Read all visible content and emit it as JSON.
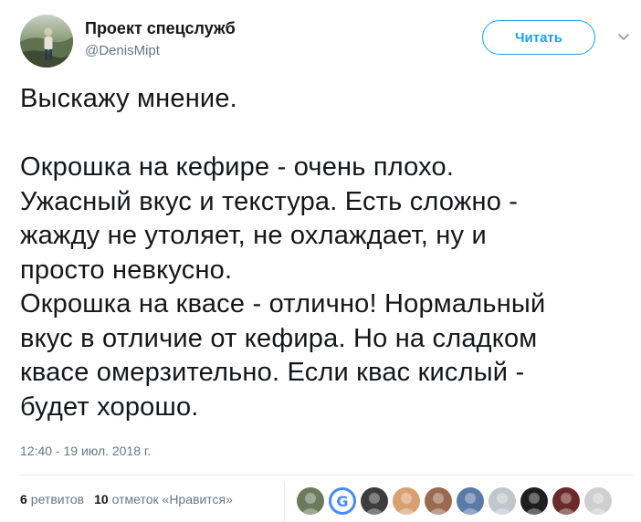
{
  "author": {
    "display_name": "Проект спецслужб",
    "handle": "@DenisMipt",
    "avatar_icon": "profile-photo-icon"
  },
  "follow_button": {
    "label": "Читать",
    "color": "#1da1f2"
  },
  "menu_caret": {
    "icon": "chevron-down-icon"
  },
  "tweet": {
    "text": "Выскажу мнение.\n\nОкрошка на кефире - очень плохо.\nУжасный вкус и текстура. Есть сложно -\nжажду не утоляет, не охлаждает, ну и\nпросто невкусно.\nОкрошка на квасе - отлично! Нормальный\nвкус в отличие от кефира. Но на сладком\nквасе омерзительно. Если квас кислый -\nбудет хорошо.",
    "timestamp": "12:40 - 19 июл. 2018 г."
  },
  "stats": {
    "retweets_count": "6",
    "retweets_label": "ретвитов",
    "likes_count": "10",
    "likes_label": "отметок «Нравится»"
  },
  "likers": [
    {
      "icon": "liker-avatar-icon",
      "color": "#6b7a5a"
    },
    {
      "icon": "google-g-icon",
      "letter": "G",
      "color": "#4a8af4"
    },
    {
      "icon": "liker-avatar-icon",
      "color": "#3d3d3d"
    },
    {
      "icon": "cat-avatar-icon",
      "color": "#d8a070"
    },
    {
      "icon": "liker-avatar-icon",
      "color": "#9a6a50"
    },
    {
      "icon": "liker-avatar-icon",
      "color": "#5a7aa8"
    },
    {
      "icon": "default-avatar-icon",
      "color": "#c0c6cc"
    },
    {
      "icon": "liker-avatar-icon",
      "color": "#1e1e1e"
    },
    {
      "icon": "liker-avatar-icon",
      "color": "#6a2a2a"
    },
    {
      "icon": "liker-avatar-icon",
      "color": "#cfcfcf"
    }
  ]
}
